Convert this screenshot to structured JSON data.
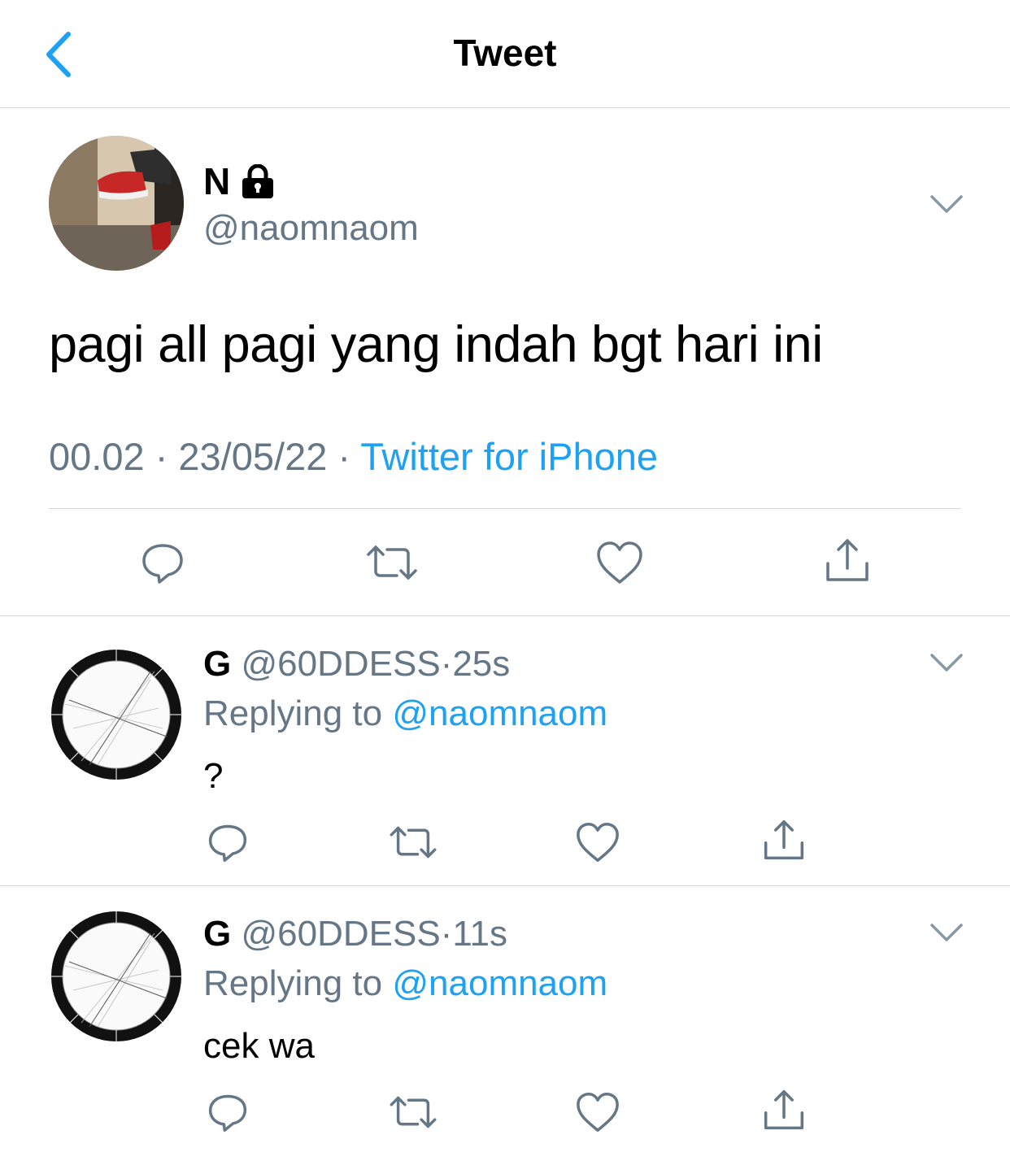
{
  "header": {
    "title": "Tweet"
  },
  "tweet": {
    "author_name": "N",
    "author_handle": "@naomnaom",
    "text": "pagi all pagi yang indah bgt hari ini",
    "time": "00.02",
    "separator": "·",
    "date": "23/05/22",
    "source": "Twitter for iPhone"
  },
  "replies": [
    {
      "name": "G",
      "handle": "@60DDESS",
      "separator": "·",
      "time": "25s",
      "replying_prefix": "Replying to ",
      "replying_to": "@naomnaom",
      "text": "?"
    },
    {
      "name": "G",
      "handle": "@60DDESS",
      "separator": "·",
      "time": "11s",
      "replying_prefix": "Replying to ",
      "replying_to": "@naomnaom",
      "text": "cek wa"
    }
  ],
  "colors": {
    "accent": "#1da1f2",
    "muted": "#657786",
    "divider": "#d3d7db"
  },
  "icons": [
    "back-chevron-icon",
    "lock-icon",
    "chevron-down-icon",
    "reply-icon",
    "retweet-icon",
    "like-icon",
    "share-icon"
  ]
}
